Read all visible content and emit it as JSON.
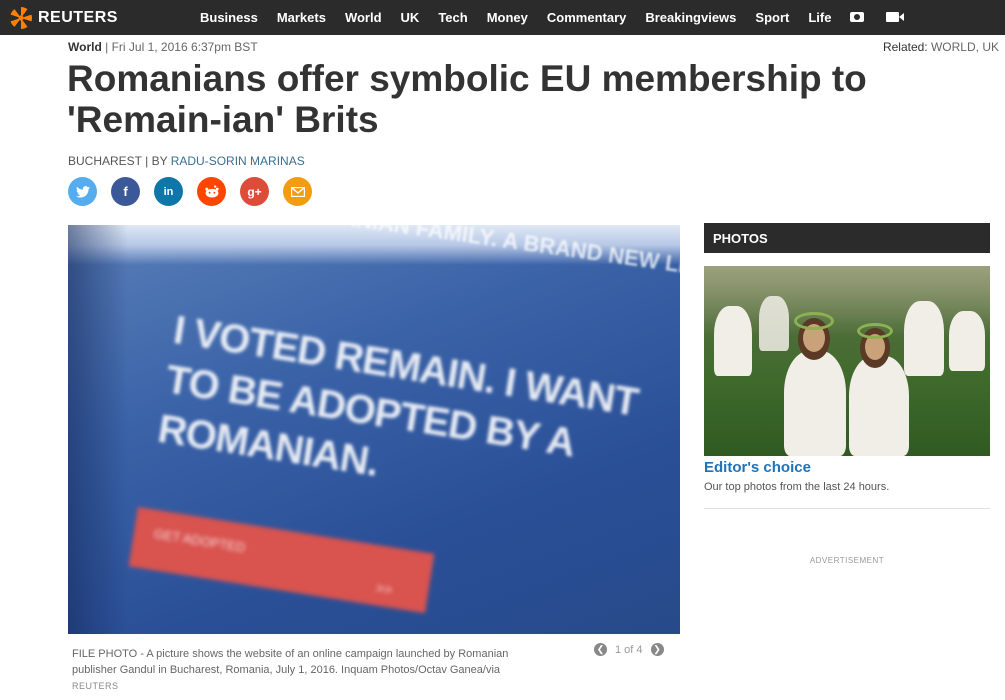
{
  "brand": {
    "name": "REUTERS",
    "accent": "#ff8000"
  },
  "nav": {
    "items": [
      "Business",
      "Markets",
      "World",
      "UK",
      "Tech",
      "Money",
      "Commentary",
      "Breakingviews",
      "Sport",
      "Life"
    ],
    "icons": [
      "camera-icon",
      "video-icon"
    ]
  },
  "meta": {
    "section": "World",
    "date": "| Fri Jul 1, 2016 6:37pm BST"
  },
  "related": {
    "label": "Related:",
    "value": "WORLD, UK"
  },
  "headline": "Romanians offer symbolic EU membership to 'Remain-ian' Brits",
  "byline": {
    "location": "BUCHAREST | BY",
    "author": "RADU-SORIN MARINAS"
  },
  "share": [
    "twitter",
    "facebook",
    "linkedin",
    "reddit",
    "google-plus",
    "email"
  ],
  "hero": {
    "small_text": "ROMANIAN FAMILY. A BRAND NEW LIFE",
    "big_text": "I VOTED REMAIN. I WANT TO BE ADOPTED BY A ROMANIAN.",
    "cta_text": "GET ADOPTED",
    "cta_arrow": ">>"
  },
  "caption": {
    "text": "FILE PHOTO - A picture shows the website of an online campaign launched by Romanian publisher Gandul in Bucharest, Romania, July 1, 2016. Inquam Photos/Octav Ganea/via",
    "credit": "REUTERS",
    "pager": "1 of 4"
  },
  "rail": {
    "photos_heading": "PHOTOS",
    "editor_title": "Editor's choice",
    "editor_sub": "Our top photos from the last 24 hours.",
    "ad_label": "ADVERTISEMENT"
  }
}
